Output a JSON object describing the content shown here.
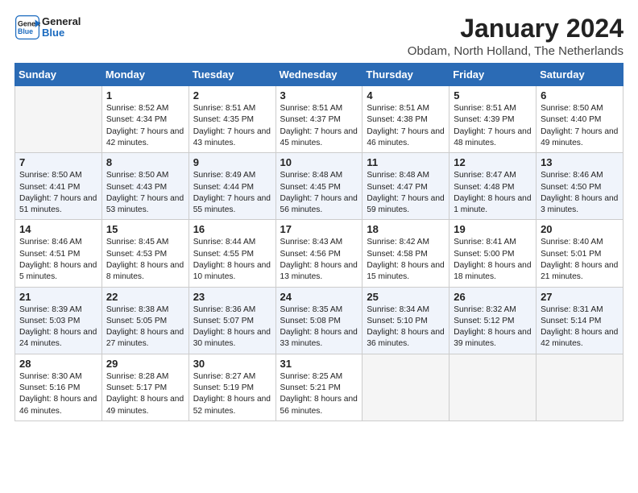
{
  "header": {
    "logo_line1": "General",
    "logo_line2": "Blue",
    "month": "January 2024",
    "location": "Obdam, North Holland, The Netherlands"
  },
  "columns": [
    "Sunday",
    "Monday",
    "Tuesday",
    "Wednesday",
    "Thursday",
    "Friday",
    "Saturday"
  ],
  "weeks": [
    {
      "days": [
        {
          "num": "",
          "empty": true
        },
        {
          "num": "1",
          "sunrise": "Sunrise: 8:52 AM",
          "sunset": "Sunset: 4:34 PM",
          "daylight": "Daylight: 7 hours and 42 minutes."
        },
        {
          "num": "2",
          "sunrise": "Sunrise: 8:51 AM",
          "sunset": "Sunset: 4:35 PM",
          "daylight": "Daylight: 7 hours and 43 minutes."
        },
        {
          "num": "3",
          "sunrise": "Sunrise: 8:51 AM",
          "sunset": "Sunset: 4:37 PM",
          "daylight": "Daylight: 7 hours and 45 minutes."
        },
        {
          "num": "4",
          "sunrise": "Sunrise: 8:51 AM",
          "sunset": "Sunset: 4:38 PM",
          "daylight": "Daylight: 7 hours and 46 minutes."
        },
        {
          "num": "5",
          "sunrise": "Sunrise: 8:51 AM",
          "sunset": "Sunset: 4:39 PM",
          "daylight": "Daylight: 7 hours and 48 minutes."
        },
        {
          "num": "6",
          "sunrise": "Sunrise: 8:50 AM",
          "sunset": "Sunset: 4:40 PM",
          "daylight": "Daylight: 7 hours and 49 minutes."
        }
      ]
    },
    {
      "days": [
        {
          "num": "7",
          "sunrise": "Sunrise: 8:50 AM",
          "sunset": "Sunset: 4:41 PM",
          "daylight": "Daylight: 7 hours and 51 minutes."
        },
        {
          "num": "8",
          "sunrise": "Sunrise: 8:50 AM",
          "sunset": "Sunset: 4:43 PM",
          "daylight": "Daylight: 7 hours and 53 minutes."
        },
        {
          "num": "9",
          "sunrise": "Sunrise: 8:49 AM",
          "sunset": "Sunset: 4:44 PM",
          "daylight": "Daylight: 7 hours and 55 minutes."
        },
        {
          "num": "10",
          "sunrise": "Sunrise: 8:48 AM",
          "sunset": "Sunset: 4:45 PM",
          "daylight": "Daylight: 7 hours and 56 minutes."
        },
        {
          "num": "11",
          "sunrise": "Sunrise: 8:48 AM",
          "sunset": "Sunset: 4:47 PM",
          "daylight": "Daylight: 7 hours and 59 minutes."
        },
        {
          "num": "12",
          "sunrise": "Sunrise: 8:47 AM",
          "sunset": "Sunset: 4:48 PM",
          "daylight": "Daylight: 8 hours and 1 minute."
        },
        {
          "num": "13",
          "sunrise": "Sunrise: 8:46 AM",
          "sunset": "Sunset: 4:50 PM",
          "daylight": "Daylight: 8 hours and 3 minutes."
        }
      ]
    },
    {
      "days": [
        {
          "num": "14",
          "sunrise": "Sunrise: 8:46 AM",
          "sunset": "Sunset: 4:51 PM",
          "daylight": "Daylight: 8 hours and 5 minutes."
        },
        {
          "num": "15",
          "sunrise": "Sunrise: 8:45 AM",
          "sunset": "Sunset: 4:53 PM",
          "daylight": "Daylight: 8 hours and 8 minutes."
        },
        {
          "num": "16",
          "sunrise": "Sunrise: 8:44 AM",
          "sunset": "Sunset: 4:55 PM",
          "daylight": "Daylight: 8 hours and 10 minutes."
        },
        {
          "num": "17",
          "sunrise": "Sunrise: 8:43 AM",
          "sunset": "Sunset: 4:56 PM",
          "daylight": "Daylight: 8 hours and 13 minutes."
        },
        {
          "num": "18",
          "sunrise": "Sunrise: 8:42 AM",
          "sunset": "Sunset: 4:58 PM",
          "daylight": "Daylight: 8 hours and 15 minutes."
        },
        {
          "num": "19",
          "sunrise": "Sunrise: 8:41 AM",
          "sunset": "Sunset: 5:00 PM",
          "daylight": "Daylight: 8 hours and 18 minutes."
        },
        {
          "num": "20",
          "sunrise": "Sunrise: 8:40 AM",
          "sunset": "Sunset: 5:01 PM",
          "daylight": "Daylight: 8 hours and 21 minutes."
        }
      ]
    },
    {
      "days": [
        {
          "num": "21",
          "sunrise": "Sunrise: 8:39 AM",
          "sunset": "Sunset: 5:03 PM",
          "daylight": "Daylight: 8 hours and 24 minutes."
        },
        {
          "num": "22",
          "sunrise": "Sunrise: 8:38 AM",
          "sunset": "Sunset: 5:05 PM",
          "daylight": "Daylight: 8 hours and 27 minutes."
        },
        {
          "num": "23",
          "sunrise": "Sunrise: 8:36 AM",
          "sunset": "Sunset: 5:07 PM",
          "daylight": "Daylight: 8 hours and 30 minutes."
        },
        {
          "num": "24",
          "sunrise": "Sunrise: 8:35 AM",
          "sunset": "Sunset: 5:08 PM",
          "daylight": "Daylight: 8 hours and 33 minutes."
        },
        {
          "num": "25",
          "sunrise": "Sunrise: 8:34 AM",
          "sunset": "Sunset: 5:10 PM",
          "daylight": "Daylight: 8 hours and 36 minutes."
        },
        {
          "num": "26",
          "sunrise": "Sunrise: 8:32 AM",
          "sunset": "Sunset: 5:12 PM",
          "daylight": "Daylight: 8 hours and 39 minutes."
        },
        {
          "num": "27",
          "sunrise": "Sunrise: 8:31 AM",
          "sunset": "Sunset: 5:14 PM",
          "daylight": "Daylight: 8 hours and 42 minutes."
        }
      ]
    },
    {
      "days": [
        {
          "num": "28",
          "sunrise": "Sunrise: 8:30 AM",
          "sunset": "Sunset: 5:16 PM",
          "daylight": "Daylight: 8 hours and 46 minutes."
        },
        {
          "num": "29",
          "sunrise": "Sunrise: 8:28 AM",
          "sunset": "Sunset: 5:17 PM",
          "daylight": "Daylight: 8 hours and 49 minutes."
        },
        {
          "num": "30",
          "sunrise": "Sunrise: 8:27 AM",
          "sunset": "Sunset: 5:19 PM",
          "daylight": "Daylight: 8 hours and 52 minutes."
        },
        {
          "num": "31",
          "sunrise": "Sunrise: 8:25 AM",
          "sunset": "Sunset: 5:21 PM",
          "daylight": "Daylight: 8 hours and 56 minutes."
        },
        {
          "num": "",
          "empty": true
        },
        {
          "num": "",
          "empty": true
        },
        {
          "num": "",
          "empty": true
        }
      ]
    }
  ]
}
